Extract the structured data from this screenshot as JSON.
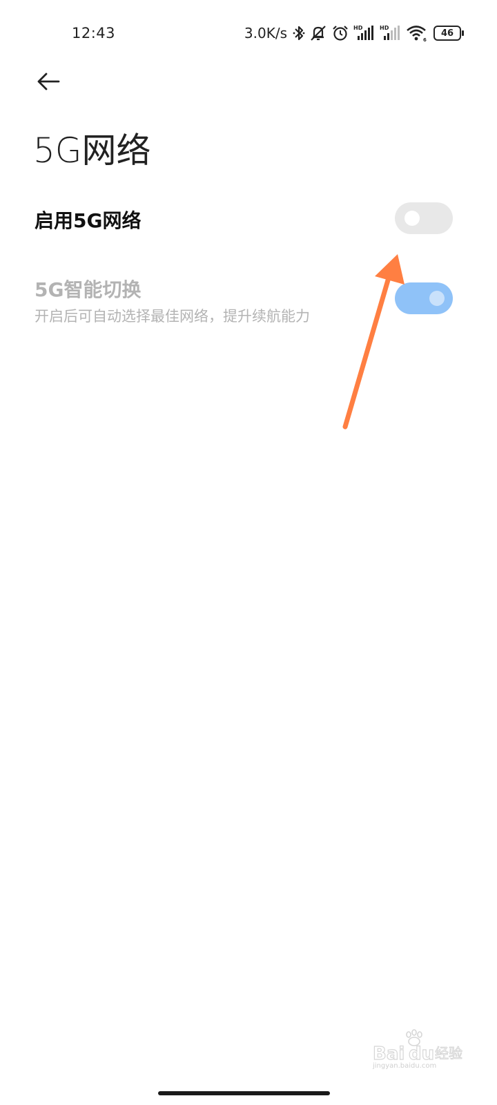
{
  "status_bar": {
    "time": "12:43",
    "net_speed": "3.0K/s",
    "battery_level": "46",
    "icons": [
      "bluetooth-icon",
      "silent-icon",
      "alarm-icon",
      "signal-hd-1-icon",
      "signal-hd-2-icon",
      "wifi-icon",
      "battery-icon"
    ]
  },
  "header": {
    "back_icon": "arrow-left-icon",
    "title": "5G网络"
  },
  "settings": [
    {
      "label": "启用5G网络",
      "enabled": true,
      "toggle_on": false,
      "toggle_track_color": "#e8e8e8"
    },
    {
      "label": "5G智能切换",
      "description": "开启后可自动选择最佳网络，提升续航能力",
      "enabled": false,
      "toggle_on": true,
      "toggle_track_color": "#8fc2f8"
    }
  ],
  "colors": {
    "annotation_arrow": "#ff7f42",
    "disabled_text": "#b3b3b3",
    "toggle_on_disabled": "#8fc2f8"
  },
  "watermark": {
    "text": "Baidu经验",
    "url": "jingyan.baidu.com"
  }
}
